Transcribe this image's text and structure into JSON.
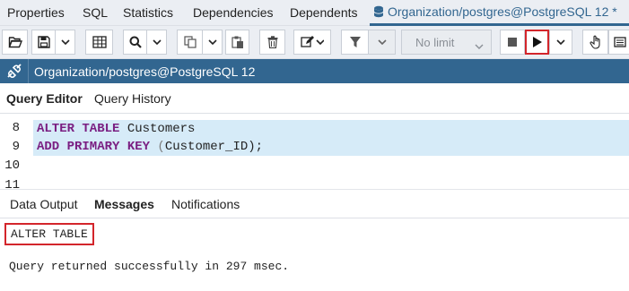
{
  "top_tabs": {
    "properties": "Properties",
    "sql": "SQL",
    "statistics": "Statistics",
    "dependencies": "Dependencies",
    "dependents": "Dependents",
    "query_tool": "Organization/postgres@PostgreSQL 12 *"
  },
  "toolbar": {
    "limit_value": "No limit"
  },
  "connection": {
    "title": "Organization/postgres@PostgreSQL 12"
  },
  "editor_tabs": {
    "query_editor": "Query Editor",
    "query_history": "Query History"
  },
  "editor": {
    "line_numbers": [
      "8",
      "9",
      "10",
      "11"
    ],
    "line8_kw": "ALTER TABLE",
    "line8_rest": " Customers",
    "line9_kw": "ADD PRIMARY KEY",
    "line9_open": " (",
    "line9_col": "Customer_ID",
    "line9_close": ");"
  },
  "result_tabs": {
    "data_output": "Data Output",
    "messages": "Messages",
    "notifications": "Notifications"
  },
  "messages": {
    "status": "ALTER TABLE",
    "detail": "Query returned successfully in 297 msec."
  },
  "colors": {
    "brand": "#326690",
    "highlight": "#d3252b",
    "keyword": "#7a1f82",
    "active_line": "#d6ebf8"
  },
  "icons": [
    "database-icon",
    "open-file-icon",
    "save-icon",
    "find-icon",
    "copy-icon",
    "paste-icon",
    "delete-icon",
    "edit-icon",
    "filter-icon",
    "stop-icon",
    "execute-icon",
    "hand-icon",
    "explain-icon",
    "connection-icon"
  ]
}
